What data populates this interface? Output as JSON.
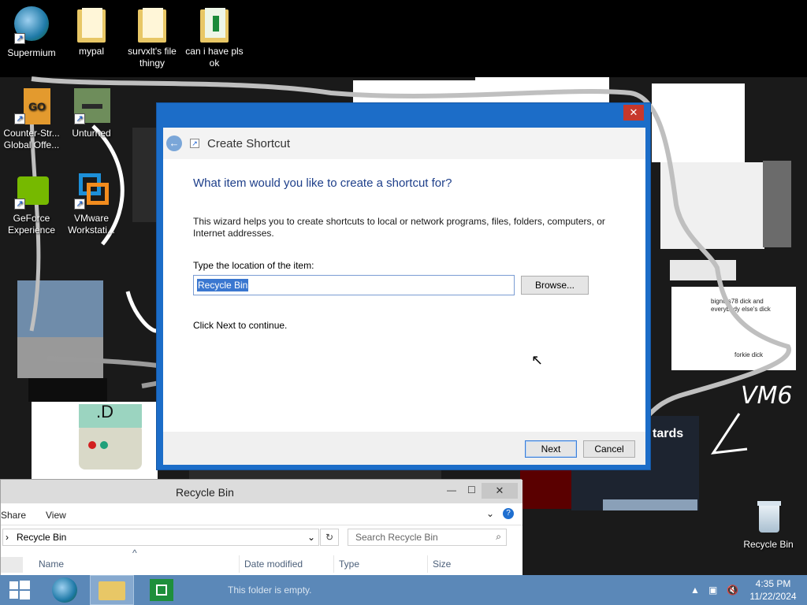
{
  "desktop": {
    "top_icons": [
      {
        "label": "Supermium"
      },
      {
        "label": "mypal"
      },
      {
        "label": "survxlt's file thingy"
      },
      {
        "label": "can i have pls ok"
      }
    ],
    "left_icons": [
      {
        "label": "Counter-Str... Global Offe..."
      },
      {
        "label": "Unturned"
      },
      {
        "label": "GeForce Experience"
      },
      {
        "label": "VMware Workstati..."
      }
    ],
    "recycle_bin": {
      "label": "Recycle Bin"
    },
    "wallpaper_text": {
      "vm6": "VM6",
      "chart_note": "bignuts78 dick and everybody else's dick",
      "chart_note2": "forkie dick",
      "d_face": ".D",
      "tards": "tards"
    }
  },
  "dialog": {
    "title": "Create Shortcut",
    "close_glyph": "✕",
    "heading": "What item would you like to create a shortcut for?",
    "description": "This wizard helps you to create shortcuts to local or network programs, files, folders, computers, or Internet addresses.",
    "location_label": "Type the location of the item:",
    "location_value": "Recycle Bin",
    "browse_label": "Browse...",
    "continue_text": "Click Next to continue.",
    "next_label": "Next",
    "cancel_label": "Cancel"
  },
  "explorer": {
    "title": "Recycle Bin",
    "ribbon_tabs": [
      "Share",
      "View"
    ],
    "address": "Recycle Bin",
    "search_placeholder": "Search Recycle Bin",
    "columns": [
      "Name",
      "Date modified",
      "Type",
      "Size"
    ],
    "empty_text": "This folder is empty."
  },
  "taskbar": {
    "time": "4:35 PM",
    "date": "11/22/2024"
  },
  "colors": {
    "dialog_frame": "#1c6dc8",
    "close_red": "#c7382c",
    "taskbar": "#5b88b8",
    "heading_blue": "#1e3f8a"
  }
}
